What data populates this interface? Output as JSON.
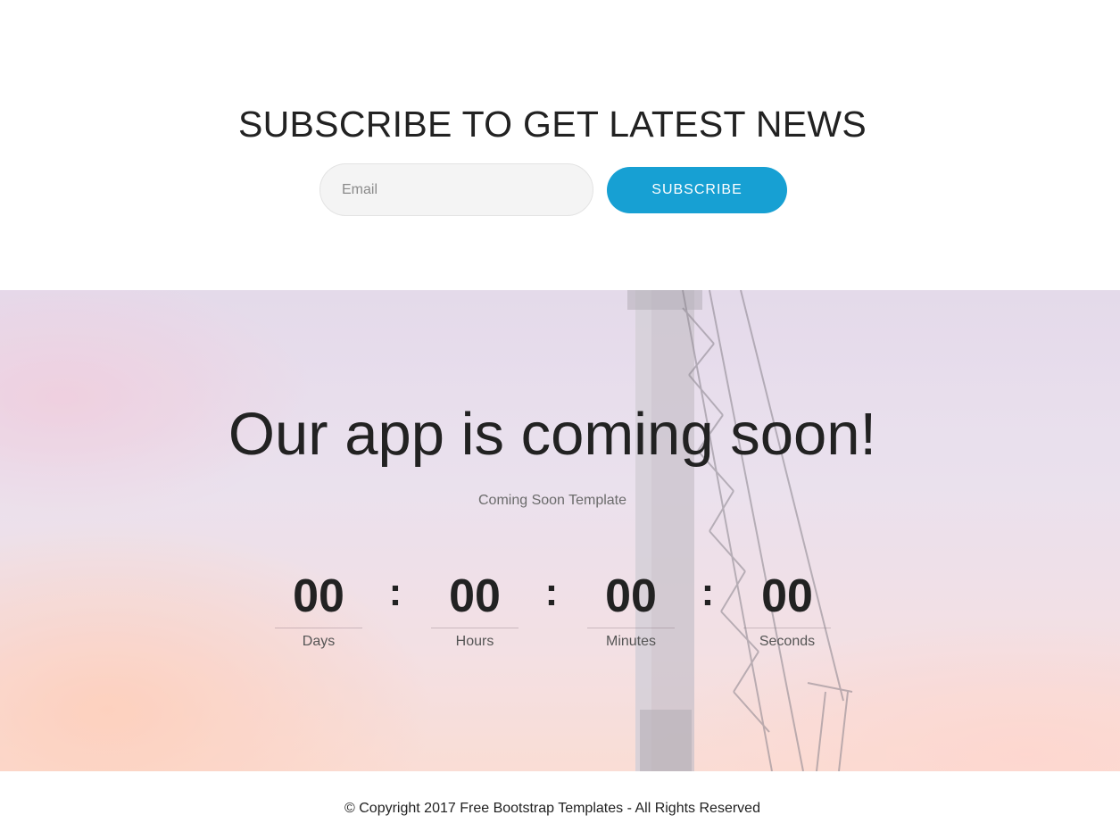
{
  "subscribe": {
    "title": "SUBSCRIBE TO GET LATEST NEWS",
    "email_placeholder": "Email",
    "button_label": "SUBSCRIBE"
  },
  "hero": {
    "title": "Our app is coming soon!",
    "subtitle": "Coming Soon Template"
  },
  "countdown": {
    "separator": ":",
    "units": [
      {
        "value": "00",
        "label": "Days"
      },
      {
        "value": "00",
        "label": "Hours"
      },
      {
        "value": "00",
        "label": "Minutes"
      },
      {
        "value": "00",
        "label": "Seconds"
      }
    ]
  },
  "footer": {
    "copyright_prefix": "© Copyright 2017 ",
    "link_text": "Free Bootstrap Templates",
    "copyright_suffix": " - All Rights Reserved"
  },
  "colors": {
    "accent": "#17a0d3",
    "text": "#222222"
  }
}
